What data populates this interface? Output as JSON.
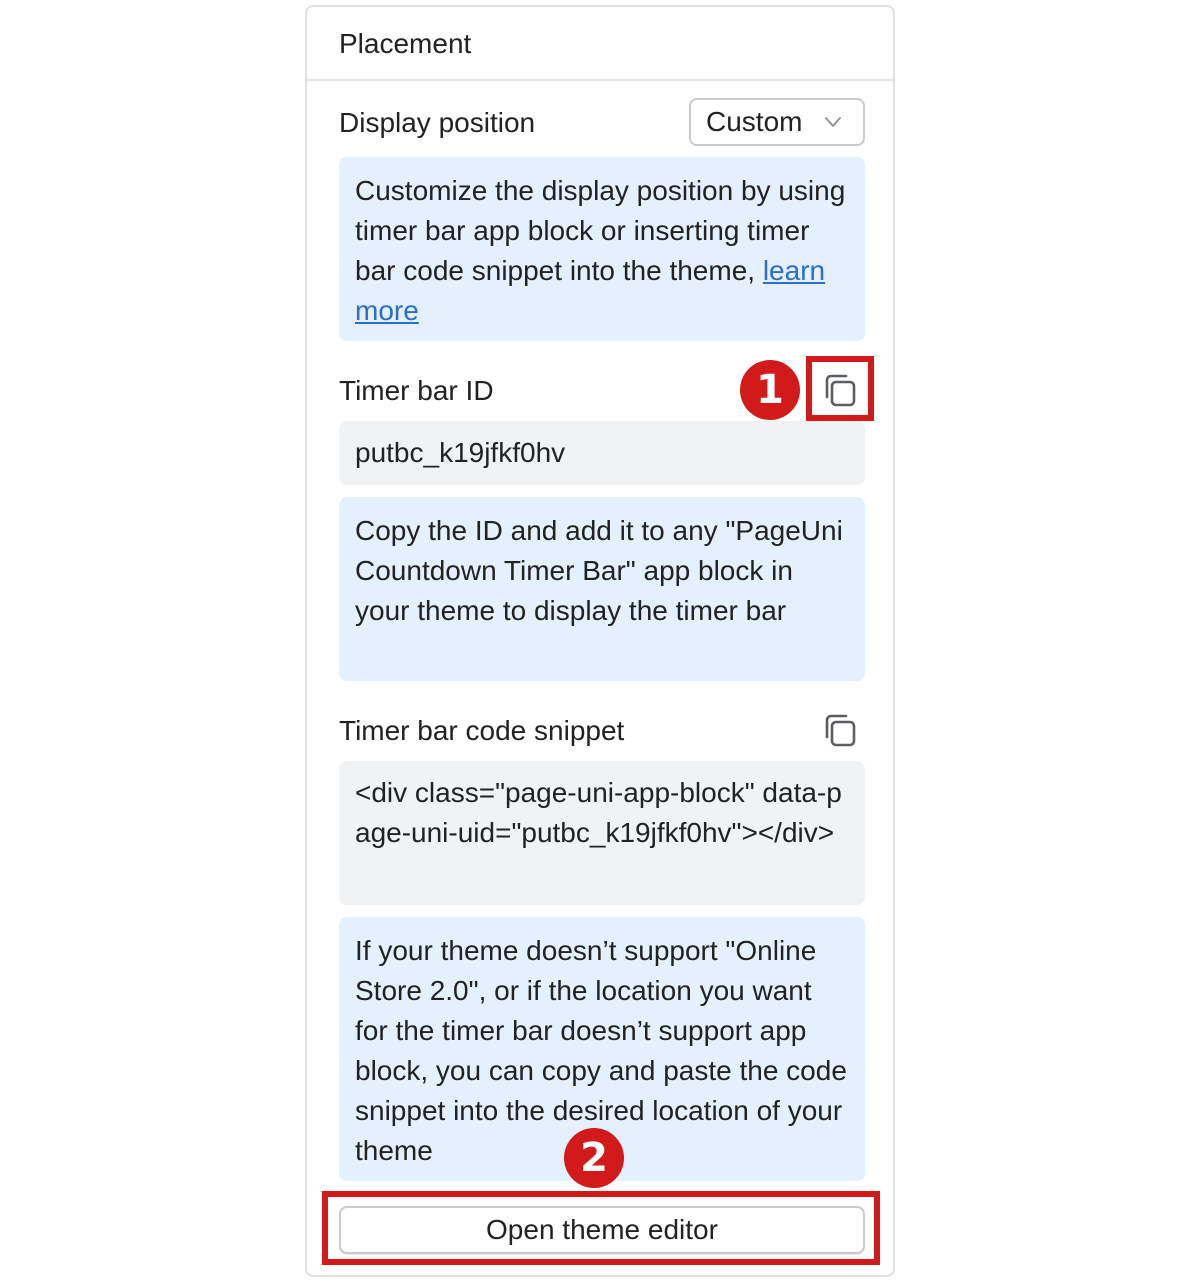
{
  "panel": {
    "title": "Placement"
  },
  "display_position": {
    "label": "Display position",
    "selected": "Custom"
  },
  "customize_info": {
    "text": "Customize the display position by using timer bar app block or inserting timer bar code snippet into the theme, ",
    "link_text": "learn more"
  },
  "timer_bar_id": {
    "label": "Timer bar ID",
    "value": "putbc_k19jfkf0hv",
    "copy_icon": "copy-icon"
  },
  "id_info": {
    "text": "Copy the ID and add it to any \"PageUni Countdown Timer Bar\" app block in your theme to display the timer bar"
  },
  "code_snippet": {
    "label": "Timer bar code snippet",
    "value": "<div class=\"page-uni-app-block\" data-page-uni-uid=\"putbc_k19jfkf0hv\"></div>",
    "copy_icon": "copy-icon"
  },
  "snippet_info": {
    "text": "If your theme doesn’t support \"Online Store 2.0\", or if the location you want for the timer bar doesn’t support app block, you can copy and paste the code snippet into the desired location of your theme"
  },
  "actions": {
    "open_theme_editor": "Open theme editor"
  },
  "annotations": {
    "step1": "1",
    "step2": "2",
    "highlight_color": "#d21a1a"
  },
  "colors": {
    "info_bg": "#e4f0fd",
    "code_bg": "#f1f2f4",
    "link": "#2c6ecb",
    "border": "#dfe1e4"
  }
}
